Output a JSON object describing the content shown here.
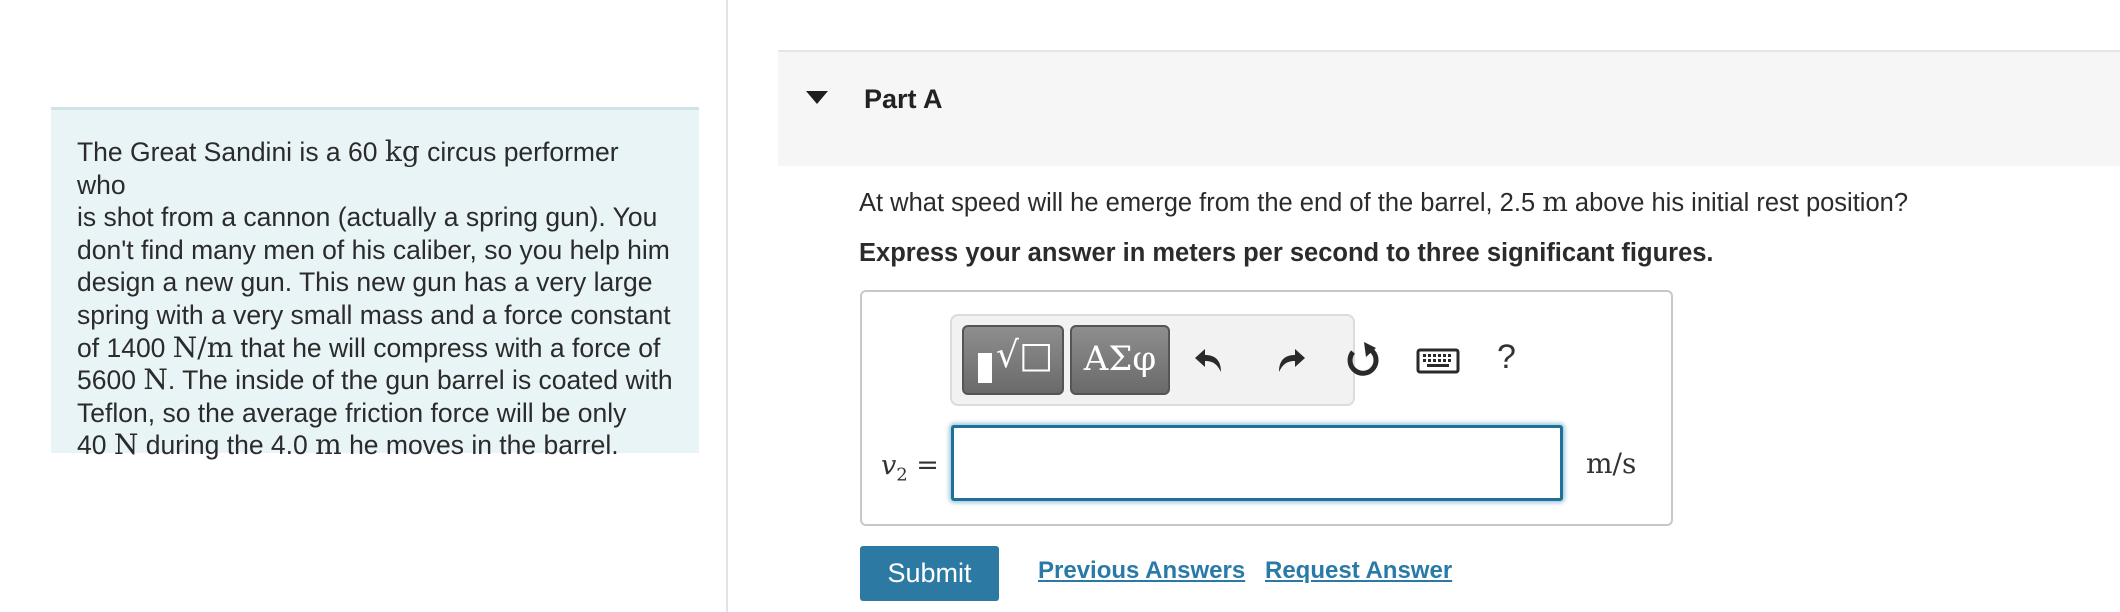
{
  "problem": {
    "l1a": "The Great Sandini is a 60 ",
    "l1u": "kg",
    "l1b": " circus performer who",
    "l2": "is shot from a cannon (actually a spring gun). You",
    "l3": "don't find many men of his caliber, so you help him",
    "l4": "design a new gun. This new gun has a very large",
    "l5": "spring with a very small mass and a force constant",
    "l6a": "of 1400 ",
    "l6u": "N/m",
    "l6b": " that he will compress with a force of",
    "l7a": "5600 ",
    "l7u": "N",
    "l7b": ". The inside of the gun barrel is coated with",
    "l8": "Teflon, so the average friction force will be only",
    "l9a": "40 ",
    "l9u": "N",
    "l9b": " during the 4.0 ",
    "l9u2": "m",
    "l9c": " he moves in the barrel."
  },
  "part": {
    "title": "Part A"
  },
  "question": {
    "text_a": "At what speed will he emerge from the end of the barrel, 2.5 ",
    "unit": "m",
    "text_b": " above his initial rest position?",
    "instruction": "Express your answer in meters per second to three significant figures."
  },
  "toolbar": {
    "symbols_label": "ΑΣφ",
    "help_label": "?",
    "icons": [
      "templates-icon",
      "undo-icon",
      "redo-icon",
      "reset-icon",
      "keyboard-icon",
      "help-icon"
    ]
  },
  "answer": {
    "var_label": "v",
    "var_sub": "2",
    "equals": " =",
    "value": "",
    "unit": "m/s"
  },
  "actions": {
    "submit_label": "Submit",
    "previous_answers_label": "Previous Answers",
    "request_answer_label": "Request Answer"
  },
  "colors": {
    "accent": "#2c7aa3",
    "link": "#2a7aa8",
    "problem_bg": "#e8f4f6",
    "input_border": "#1f6f98"
  }
}
